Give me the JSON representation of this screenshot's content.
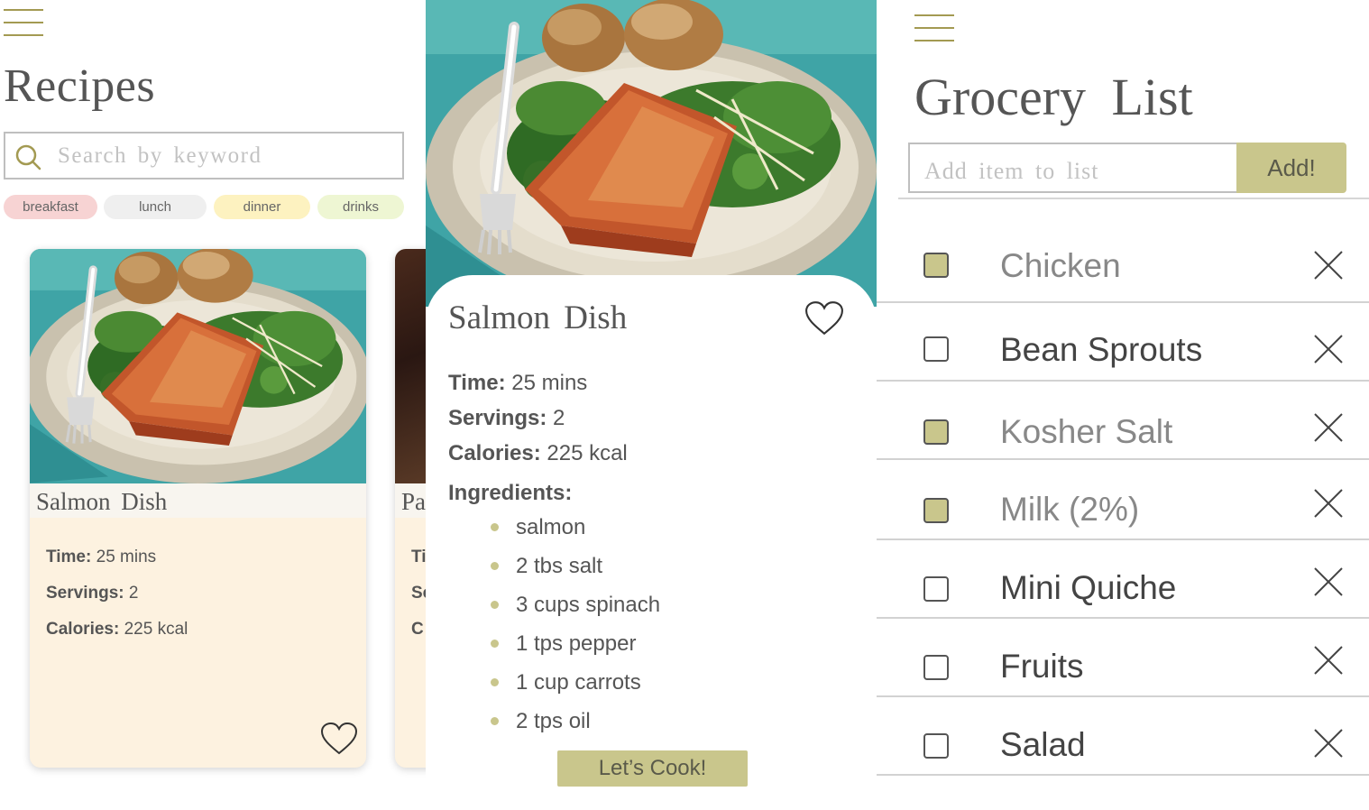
{
  "recipes_screen": {
    "title": "Recipes",
    "search": {
      "placeholder": "Search by keyword",
      "value": ""
    },
    "categories": [
      {
        "label": "breakfast",
        "color": "#f7d3d3"
      },
      {
        "label": "lunch",
        "color": "#efefef"
      },
      {
        "label": "dinner",
        "color": "#fdf2c0"
      },
      {
        "label": "drinks",
        "color": "#eef6d3"
      }
    ],
    "cards": [
      {
        "name": "Salmon Dish",
        "time_label": "Time:",
        "time_value": "25 mins",
        "servings_label": "Servings:",
        "servings_value": "2",
        "calories_label": "Calories:",
        "calories_value": "225 kcal",
        "image": "salmon-dish-photo",
        "favorite_icon": "heart-outline-icon"
      },
      {
        "name_visible": "Pa",
        "line1_visible": "Ti",
        "line2_visible": "Se",
        "line3_visible": "C"
      }
    ]
  },
  "detail_screen": {
    "title": "Salmon Dish",
    "favorite_icon": "heart-outline-icon",
    "time_label": "Time:",
    "time_value": "25 mins",
    "servings_label": "Servings:",
    "servings_value": "2",
    "calories_label": "Calories:",
    "calories_value": "225 kcal",
    "ingredients_label": "Ingredients:",
    "ingredients": [
      "salmon",
      "2 tbs salt",
      "3 cups spinach",
      "1 tps pepper",
      "1 cup carrots",
      "2 tps oil"
    ],
    "cook_button": "Let’s Cook!"
  },
  "grocery_screen": {
    "title": "Grocery List",
    "add_placeholder": "Add item to list",
    "add_button": "Add!",
    "items": [
      {
        "label": "Chicken",
        "checked": true
      },
      {
        "label": "Bean Sprouts",
        "checked": false
      },
      {
        "label": "Kosher Salt",
        "checked": true
      },
      {
        "label": "Milk (2%)",
        "checked": true
      },
      {
        "label": "Mini Quiche",
        "checked": false
      },
      {
        "label": "Fruits",
        "checked": false
      },
      {
        "label": "Salad",
        "checked": false
      }
    ]
  },
  "colors": {
    "accent": "#c9c68c",
    "hamburger": "#a39a52",
    "card_background": "#fdf2e0",
    "text": "#555555"
  },
  "icons": [
    "menu-icon",
    "search-icon",
    "heart-outline-icon",
    "close-icon",
    "checkbox"
  ]
}
